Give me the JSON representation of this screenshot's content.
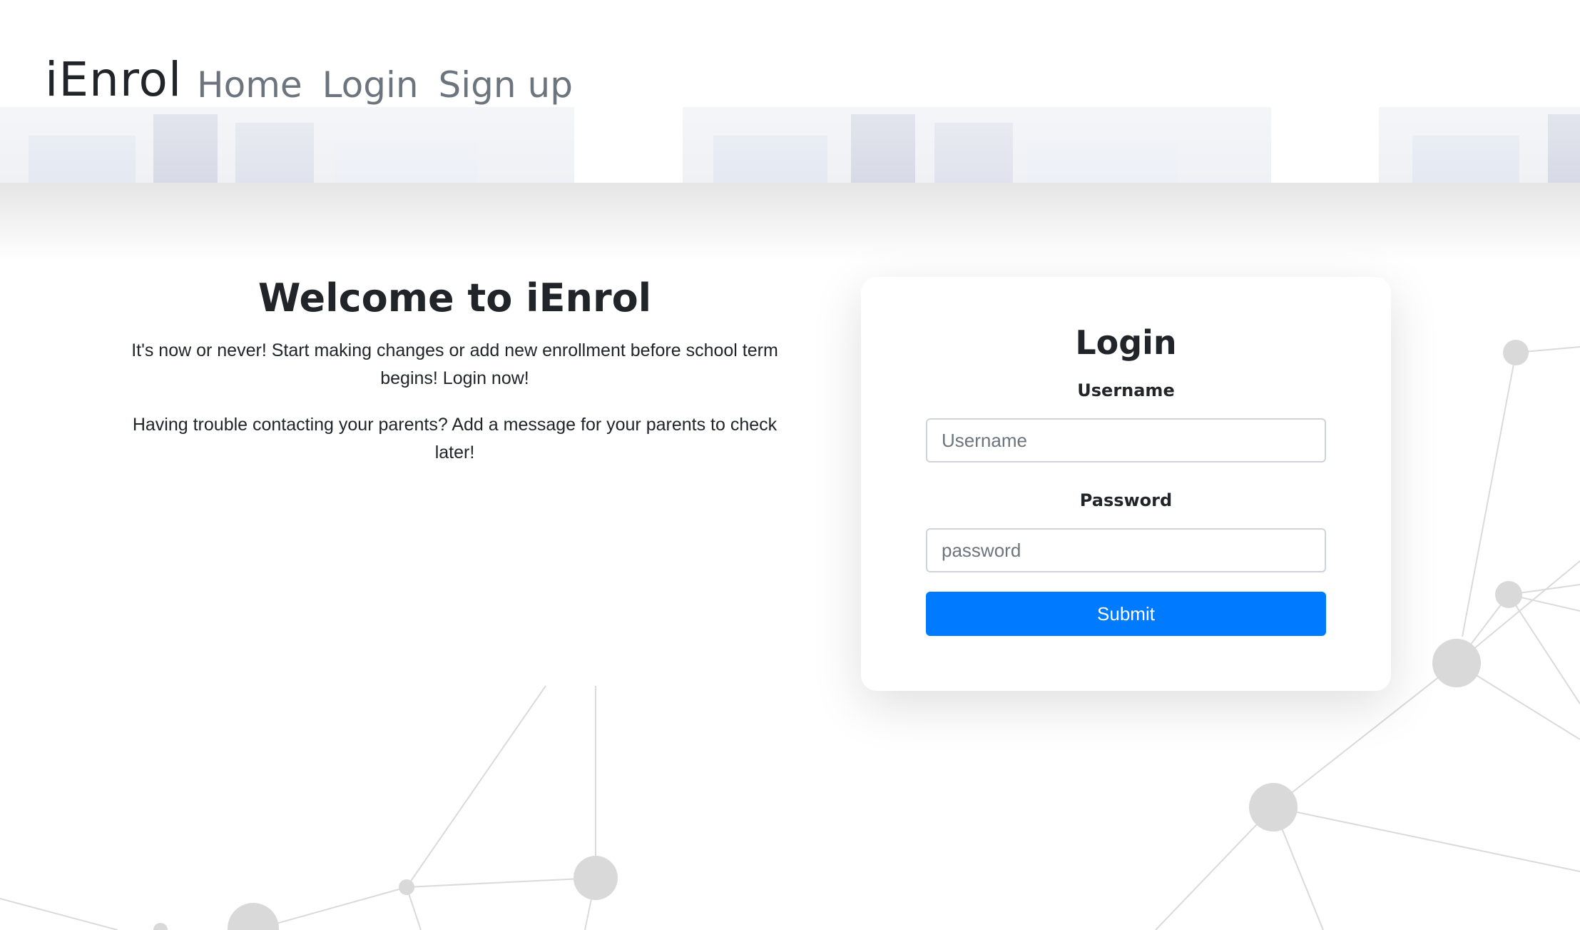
{
  "header": {
    "brand": "iEnrol",
    "nav": [
      {
        "label": "Home"
      },
      {
        "label": "Login"
      },
      {
        "label": "Sign up"
      }
    ]
  },
  "welcome": {
    "title": "Welcome to iEnrol",
    "paragraphs": [
      "It's now or never! Start making changes or add new enrollment before school term begins! Login now!",
      "Having trouble contacting your parents? Add a message for your parents to check later!"
    ]
  },
  "login_form": {
    "title": "Login",
    "username_label": "Username",
    "username_placeholder": "Username",
    "username_value": "",
    "password_label": "Password",
    "password_placeholder": "password",
    "password_value": "",
    "submit_label": "Submit"
  },
  "colors": {
    "primary_button": "#007bff",
    "nav_link": "#6c757d",
    "text": "#212529",
    "network_nodes": "#d9d9d9"
  }
}
